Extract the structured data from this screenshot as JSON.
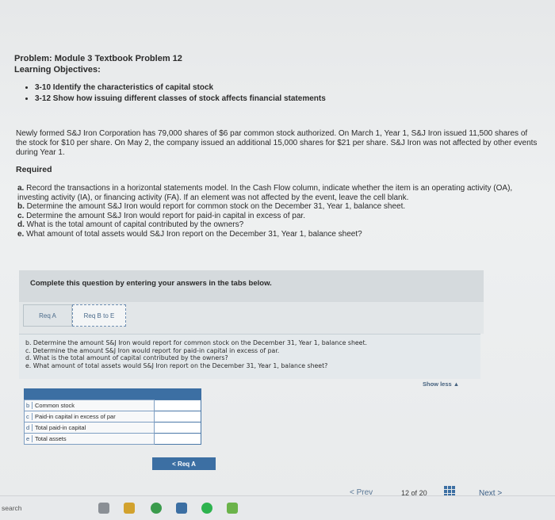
{
  "problem": {
    "title": "Problem: Module 3 Textbook Problem 12",
    "objectives_heading": "Learning Objectives:",
    "objectives": [
      "3-10 Identify the characteristics of capital stock",
      "3-12 Show how issuing different classes of stock affects financial statements"
    ],
    "intro": "Newly formed S&J Iron Corporation has 79,000 shares of $6 par common stock authorized. On March 1, Year 1, S&J Iron issued 11,500 shares of the stock for $10 per share. On May 2, the company issued an additional 15,000 shares for $21 per share. S&J Iron was not affected by other events during Year 1.",
    "required_heading": "Required",
    "requirements": [
      {
        "key": "a.",
        "text": "Record the transactions in a horizontal statements model. In the Cash Flow column, indicate whether the item is an operating activity (OA), investing activity (IA), or financing activity (FA). If an element was not affected by the event, leave the cell blank."
      },
      {
        "key": "b.",
        "text": "Determine the amount S&J Iron would report for common stock on the December 31, Year 1, balance sheet."
      },
      {
        "key": "c.",
        "text": "Determine the amount S&J Iron would report for paid-in capital in excess of par."
      },
      {
        "key": "d.",
        "text": "What is the total amount of capital contributed by the owners?"
      },
      {
        "key": "e.",
        "text": "What amount of total assets would S&J Iron report on the December 31, Year 1, balance sheet?"
      }
    ]
  },
  "panel": {
    "instruction": "Complete this question by entering your answers in the tabs below.",
    "tabs": [
      "Req A",
      "Req B to E"
    ],
    "questions": [
      "b. Determine the amount S&J Iron would report for common stock on the December 31, Year 1, balance sheet.",
      "c. Determine the amount S&J Iron would report for paid-in capital in excess of par.",
      "d. What is the total amount of capital contributed by the owners?",
      "e. What amount of total assets would S&J Iron report on the December 31, Year 1, balance sheet?"
    ],
    "show_less": "Show less ▲",
    "table_rows": [
      {
        "key": "b",
        "label": "Common stock",
        "value": ""
      },
      {
        "key": "c",
        "label": "Paid-in capital in excess of par",
        "value": ""
      },
      {
        "key": "d",
        "label": "Total paid-in capital",
        "value": ""
      },
      {
        "key": "e",
        "label": "Total assets",
        "value": ""
      }
    ],
    "back_button": "< Req A"
  },
  "nav": {
    "prev": "< Prev",
    "page_current": "12",
    "page_of": "of",
    "page_total": "20",
    "next": "Next >"
  },
  "taskbar": {
    "search": "search",
    "icons": [
      "task-view-icon",
      "file-explorer-icon",
      "chrome-icon",
      "app-icon",
      "spotify-icon",
      "green-app-icon"
    ]
  },
  "colors": {
    "accent": "#3c6fa3",
    "panel": "#d5dadd"
  }
}
